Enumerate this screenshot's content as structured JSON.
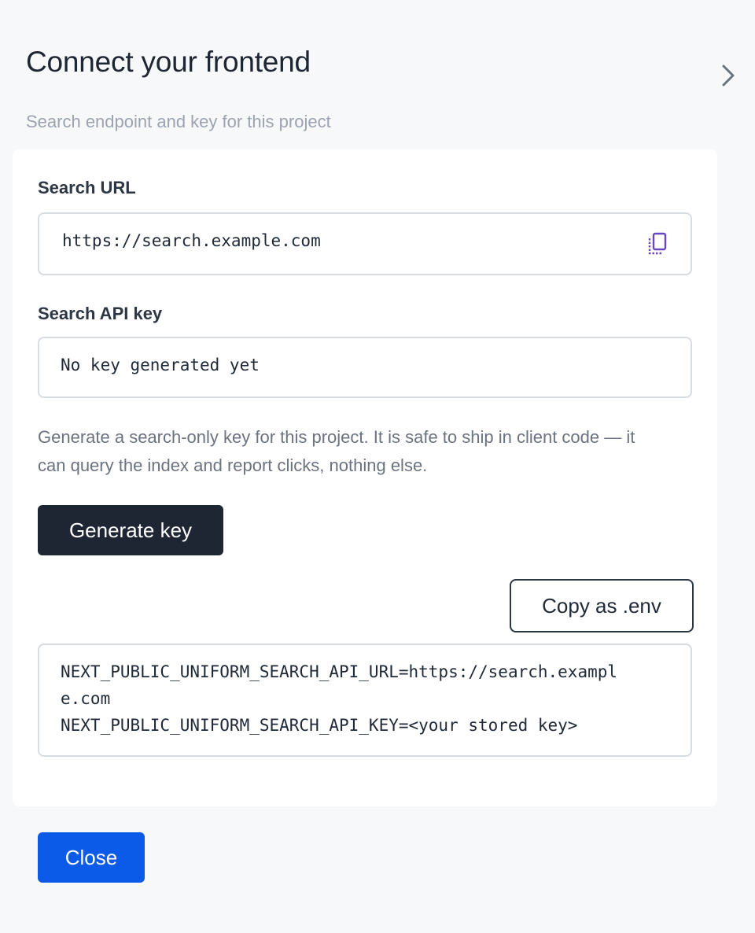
{
  "dialog": {
    "title": "Connect your frontend",
    "subtitle": "Search endpoint and key for this project"
  },
  "search_url": {
    "label": "Search URL",
    "value": "https://search.example.com",
    "copy_icon": "copy-icon"
  },
  "api_key": {
    "label": "Search API key",
    "value": "No key generated yet"
  },
  "help_text": "Generate a search-only key for this project. It is safe to ship in client code — it can query the index and report clicks, nothing else.",
  "buttons": {
    "generate": "Generate key",
    "copy_env": "Copy as .env",
    "close": "Close"
  },
  "env": {
    "lines": [
      "NEXT_PUBLIC_UNIFORM_SEARCH_API_URL=https://search.exampl",
      "e.com",
      "NEXT_PUBLIC_UNIFORM_SEARCH_API_KEY=<your stored key>"
    ]
  },
  "colors": {
    "accent": "#0b5ae8",
    "dark_button": "#1f2633",
    "copy_icon": "#6b46c1"
  }
}
